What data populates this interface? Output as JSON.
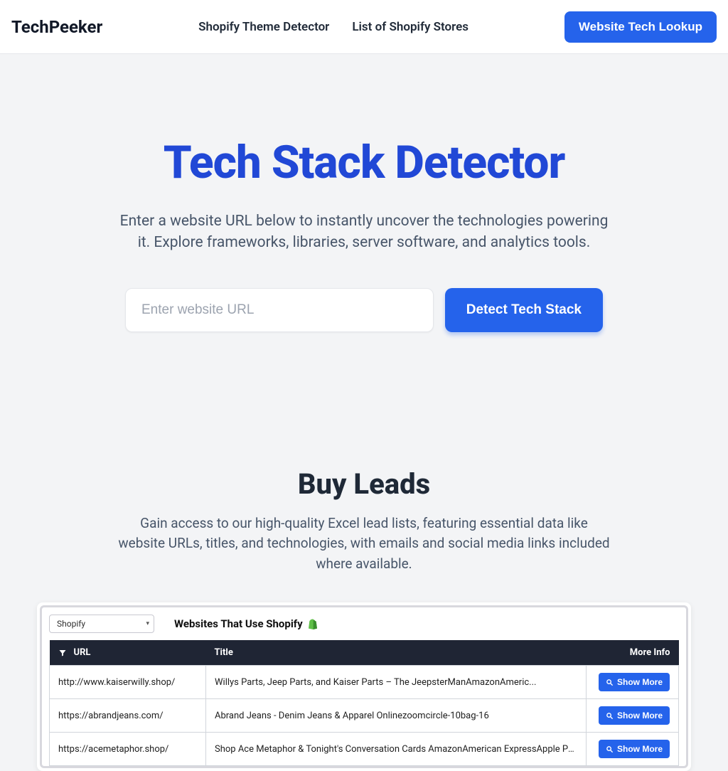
{
  "nav": {
    "logo": "TechPeeker",
    "links": [
      "Shopify Theme Detector",
      "List of Shopify Stores"
    ],
    "cta": "Website Tech Lookup"
  },
  "hero": {
    "title": "Tech Stack Detector",
    "subtitle": "Enter a website URL below to instantly uncover the technologies powering it. Explore frameworks, libraries, server software, and analytics tools.",
    "placeholder": "Enter website URL",
    "button": "Detect Tech Stack"
  },
  "leads": {
    "title": "Buy Leads",
    "subtitle": "Gain access to our high-quality Excel lead lists, featuring essential data like website URLs, titles, and technologies, with emails and social media links included where available.",
    "preview": {
      "select_value": "Shopify",
      "heading": "Websites That Use Shopify",
      "columns": {
        "url": "URL",
        "title": "Title",
        "more": "More Info"
      },
      "show_more_label": "Show More",
      "rows": [
        {
          "url": "http://www.kaiserwilly.shop/",
          "title": "Willys Parts, Jeep Parts, and Kaiser Parts – The JeepsterManAmazonAmeric..."
        },
        {
          "url": "https://abrandjeans.com/",
          "title": "Abrand Jeans - Denim Jeans & Apparel Onlinezoomcircle-10bag-16"
        },
        {
          "url": "https://acemetaphor.shop/",
          "title": "Shop Ace Metaphor & Tonight's Conversation Cards AmazonAmerican ExpressApple Pay..."
        }
      ]
    }
  }
}
